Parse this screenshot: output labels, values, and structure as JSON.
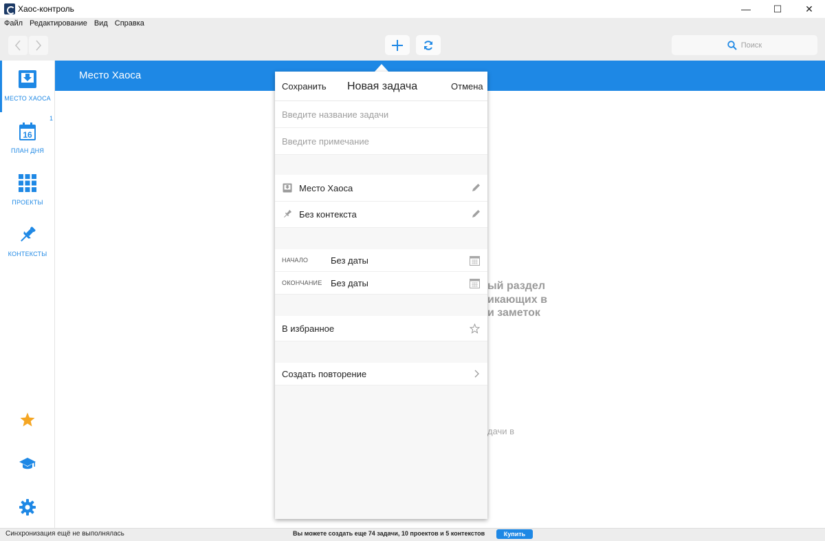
{
  "window": {
    "title": "Хаос-контроль",
    "controls": {
      "minimize": "—",
      "maximize": "☐",
      "close": "✕"
    }
  },
  "menu": [
    "Файл",
    "Редактирование",
    "Вид",
    "Справка"
  ],
  "toolbar": {
    "back_icon": "chevron-left-icon",
    "forward_icon": "chevron-right-icon",
    "add_icon": "plus-icon",
    "sync_icon": "refresh-icon",
    "search_placeholder": "Поиск"
  },
  "sidebar": {
    "items": [
      {
        "label": "МЕСТО ХАОСА",
        "icon": "inbox-icon",
        "active": true
      },
      {
        "label": "ПЛАН ДНЯ",
        "icon": "calendar-icon",
        "calendar_day": "16",
        "badge": "1"
      },
      {
        "label": "ПРОЕКТЫ",
        "icon": "grid-icon"
      },
      {
        "label": "КОНТЕКСТЫ",
        "icon": "pin-icon"
      }
    ],
    "bottom": [
      "star-icon",
      "graduation-cap-icon",
      "gear-icon"
    ]
  },
  "header": {
    "title": "Место Хаоса"
  },
  "background_text": {
    "line1": "ый раздел",
    "line2": "икающих в",
    "line3": "и заметок",
    "line4": "дачи в"
  },
  "popup": {
    "save_label": "Сохранить",
    "title": "Новая задача",
    "cancel_label": "Отмена",
    "name_placeholder": "Введите название задачи",
    "note_placeholder": "Введите примечание",
    "project": "Место Хаоса",
    "context": "Без контекста",
    "start_label": "НАЧАЛО",
    "start_value": "Без даты",
    "end_label": "ОКОНЧАНИЕ",
    "end_value": "Без даты",
    "favorite_label": "В избранное",
    "repeat_label": "Создать повторение"
  },
  "status": {
    "sync": "Синхронизация ещё не выполнялась",
    "limits": "Вы можете создать еще 74 задачи, 10 проектов и 5 контекстов",
    "buy_label": "Купить"
  },
  "colors": {
    "accent": "#1e88e5",
    "star": "#f5a623",
    "chrome": "#ededed"
  }
}
